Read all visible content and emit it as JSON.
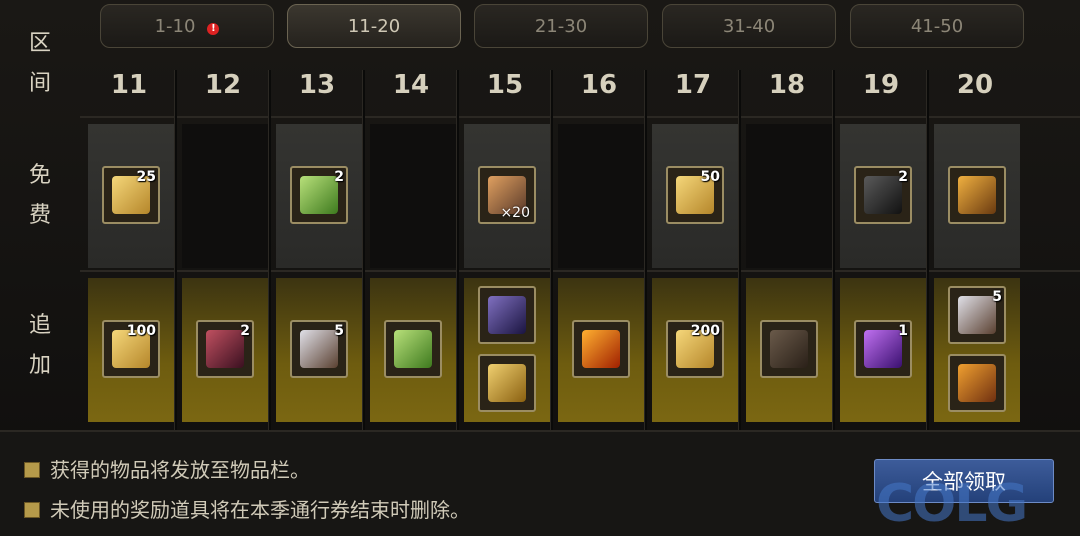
{
  "tabs": [
    {
      "label": "1-10",
      "alert": "!"
    },
    {
      "label": "11-20"
    },
    {
      "label": "21-30"
    },
    {
      "label": "31-40"
    },
    {
      "label": "41-50"
    }
  ],
  "side": {
    "range": "区\n间",
    "free": "免\n费",
    "plus": "追\n加",
    "range_a": "区",
    "range_b": "间",
    "free_a": "免",
    "free_b": "费",
    "plus_a": "追",
    "plus_b": "加"
  },
  "levels": [
    "11",
    "12",
    "13",
    "14",
    "15",
    "16",
    "17",
    "18",
    "19",
    "20"
  ],
  "free_items": {
    "11": {
      "icon": "gold-ticket-icon",
      "count": "25"
    },
    "13": {
      "icon": "green-cube-icon",
      "count": "2"
    },
    "15": {
      "icon": "dye-bundle-icon",
      "count": "×20"
    },
    "17": {
      "icon": "gold-ticket-icon",
      "count": "50"
    },
    "19": {
      "icon": "dark-cube-icon",
      "count": "2"
    },
    "20": {
      "icon": "golden-box-icon",
      "count": ""
    }
  },
  "plus_items": {
    "11": [
      {
        "icon": "gold-ticket-icon",
        "count": "100"
      }
    ],
    "12": [
      {
        "icon": "red-cube-icon",
        "count": "2"
      }
    ],
    "13": [
      {
        "icon": "silver-anvil-icon",
        "count": "5"
      }
    ],
    "14": [
      {
        "icon": "green-cube-icon",
        "count": ""
      }
    ],
    "15": [
      {
        "icon": "purple-chest-icon",
        "count": ""
      },
      {
        "icon": "golden-book-icon",
        "count": ""
      }
    ],
    "16": [
      {
        "icon": "flame-crystal-icon",
        "count": ""
      }
    ],
    "17": [
      {
        "icon": "gold-ticket-icon",
        "count": "200"
      }
    ],
    "18": [
      {
        "icon": "wings-icon",
        "count": ""
      }
    ],
    "19": [
      {
        "icon": "purple-cube-icon",
        "count": "1"
      }
    ],
    "20": [
      {
        "icon": "silver-anvil-icon",
        "count": "5"
      },
      {
        "icon": "golden-pouch-icon",
        "count": ""
      }
    ]
  },
  "notes": [
    "获得的物品将发放至物品栏。",
    "未使用的奖励道具将在本季通行券结束时删除。"
  ],
  "claim_label": "全部领取",
  "watermark": "COLG",
  "colors": {
    "gold": "#7b6712",
    "free_cell": "#2e2e2c",
    "claim": "#2b4a85"
  }
}
